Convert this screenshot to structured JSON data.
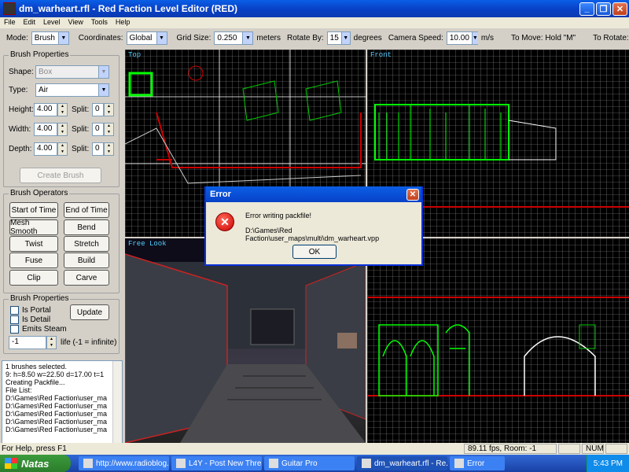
{
  "window": {
    "title": "dm_warheart.rfl - Red Faction Level Editor (RED)"
  },
  "menu": [
    "File",
    "Edit",
    "Level",
    "View",
    "Tools",
    "Help"
  ],
  "toolbar": {
    "mode_label": "Mode:",
    "mode_value": "Brush",
    "coords_label": "Coordinates:",
    "coords_value": "Global",
    "grid_label": "Grid Size:",
    "grid_value": "0.250",
    "grid_unit": "meters",
    "rotate_label": "Rotate By:",
    "rotate_value": "15",
    "rotate_unit": "degrees",
    "camera_label": "Camera Speed:",
    "camera_value": "10.00",
    "camera_unit": "m/s",
    "tomove": "To Move:  Hold \"M\"",
    "torotate": "To Rotate:"
  },
  "brush_properties": {
    "title": "Brush Properties",
    "shape_label": "Shape:",
    "shape_value": "Box",
    "type_label": "Type:",
    "type_value": "Air",
    "height_label": "Height:",
    "height_value": "4.00",
    "width_label": "Width:",
    "width_value": "4.00",
    "depth_label": "Depth:",
    "depth_value": "4.00",
    "split_label": "Split:",
    "split_values": [
      "0",
      "0",
      "0"
    ],
    "create_label": "Create Brush"
  },
  "brush_operators": {
    "title": "Brush Operators",
    "buttons": [
      "Start of Time",
      "End of Time",
      "Mesh Smooth",
      "Bend",
      "Twist",
      "Stretch",
      "Fuse",
      "Build",
      "Clip",
      "Carve"
    ]
  },
  "brush_props2": {
    "title": "Brush Properties",
    "portal": "Is Portal",
    "detail": "Is Detail",
    "steam": "Emits Steam",
    "update": "Update",
    "life_value": "-1",
    "life_label": "life (-1 = infinite)"
  },
  "log": [
    "1 brushes selected.",
    "9: h=8.50 w=22.50 d=17.00 t=1",
    "Creating Packfile...",
    "File List:",
    "D:\\Games\\Red Faction\\user_ma",
    "D:\\Games\\Red Faction\\user_ma",
    "D:\\Games\\Red Faction\\user_ma",
    "D:\\Games\\Red Faction\\user_ma",
    "D:\\Games\\Red Faction\\user_ma"
  ],
  "viewports": {
    "top": "Top",
    "front": "Front",
    "free": "Free Look"
  },
  "dialog": {
    "title": "Error",
    "message": "Error writing packfile!",
    "path": "D:\\Games\\Red Faction\\user_maps\\multi\\dm_warheart.vpp",
    "ok": "OK"
  },
  "status": {
    "help": "For Help, press F1",
    "fps": "89.11 fps, Room: -1",
    "num": "NUM"
  },
  "taskbar": {
    "start": "Natas",
    "tasks": [
      "http://www.radioblog...",
      "L4Y - Post New Threa...",
      "Guitar Pro",
      "dm_warheart.rfl - Re...",
      "Error"
    ],
    "clock": "5:43 PM"
  }
}
